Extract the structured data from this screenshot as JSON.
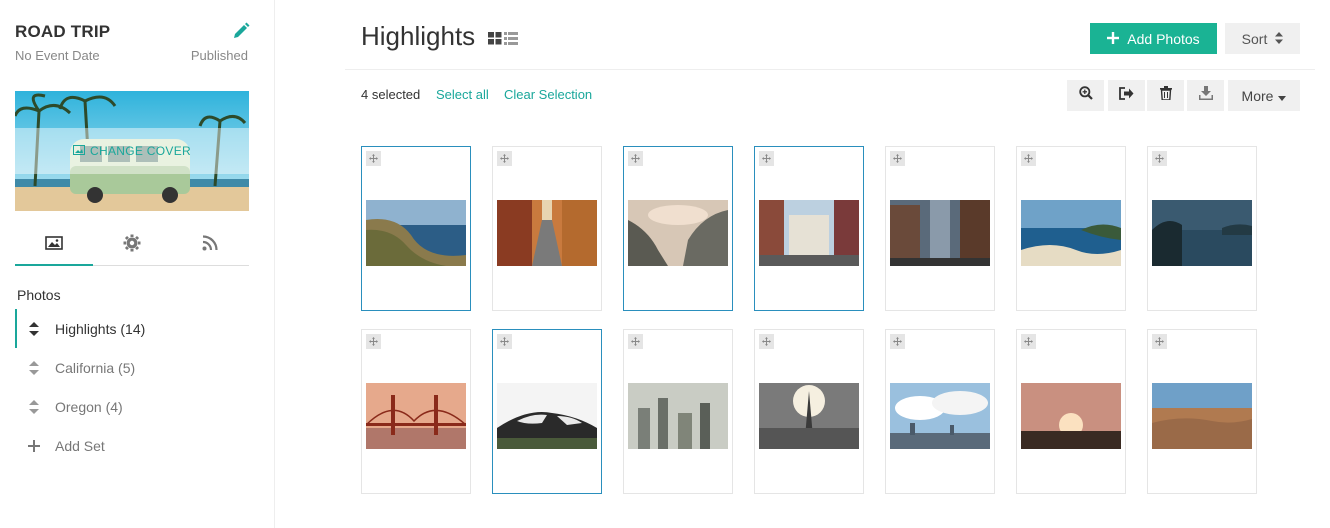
{
  "sidebar": {
    "event_title": "ROAD TRIP",
    "event_date": "No Event Date",
    "event_status": "Published",
    "change_cover_label": "CHANGE COVER",
    "tabs": [
      {
        "icon": "image-icon"
      },
      {
        "icon": "gear-icon"
      },
      {
        "icon": "rss-icon"
      }
    ],
    "photos_heading": "Photos",
    "sets": [
      {
        "label": "Highlights (14)",
        "active": true
      },
      {
        "label": "California (5)",
        "active": false
      },
      {
        "label": "Oregon (4)",
        "active": false
      }
    ],
    "add_set_label": "Add Set"
  },
  "main": {
    "title": "Highlights",
    "add_photos_label": "Add Photos",
    "sort_label": "Sort",
    "selected_count": "4 selected",
    "select_all_label": "Select all",
    "clear_selection_label": "Clear Selection",
    "more_label": "More",
    "photos": [
      {
        "selected": true,
        "scene": "coast-cliffs"
      },
      {
        "selected": false,
        "scene": "alley"
      },
      {
        "selected": true,
        "scene": "misty-cliff"
      },
      {
        "selected": true,
        "scene": "street-buildings"
      },
      {
        "selected": false,
        "scene": "city-towers"
      },
      {
        "selected": false,
        "scene": "beach-bay"
      },
      {
        "selected": false,
        "scene": "dusk-lake"
      },
      {
        "selected": false,
        "scene": "golden-gate"
      },
      {
        "selected": true,
        "scene": "snowy-hill"
      },
      {
        "selected": false,
        "scene": "foggy-city"
      },
      {
        "selected": false,
        "scene": "paris-sun"
      },
      {
        "selected": false,
        "scene": "skyline-clouds"
      },
      {
        "selected": false,
        "scene": "sunset-field"
      },
      {
        "selected": false,
        "scene": "desert-town"
      }
    ]
  },
  "colors": {
    "accent": "#1aa79b",
    "add_button": "#1ab394",
    "selected_border": "#2a8fbd"
  }
}
